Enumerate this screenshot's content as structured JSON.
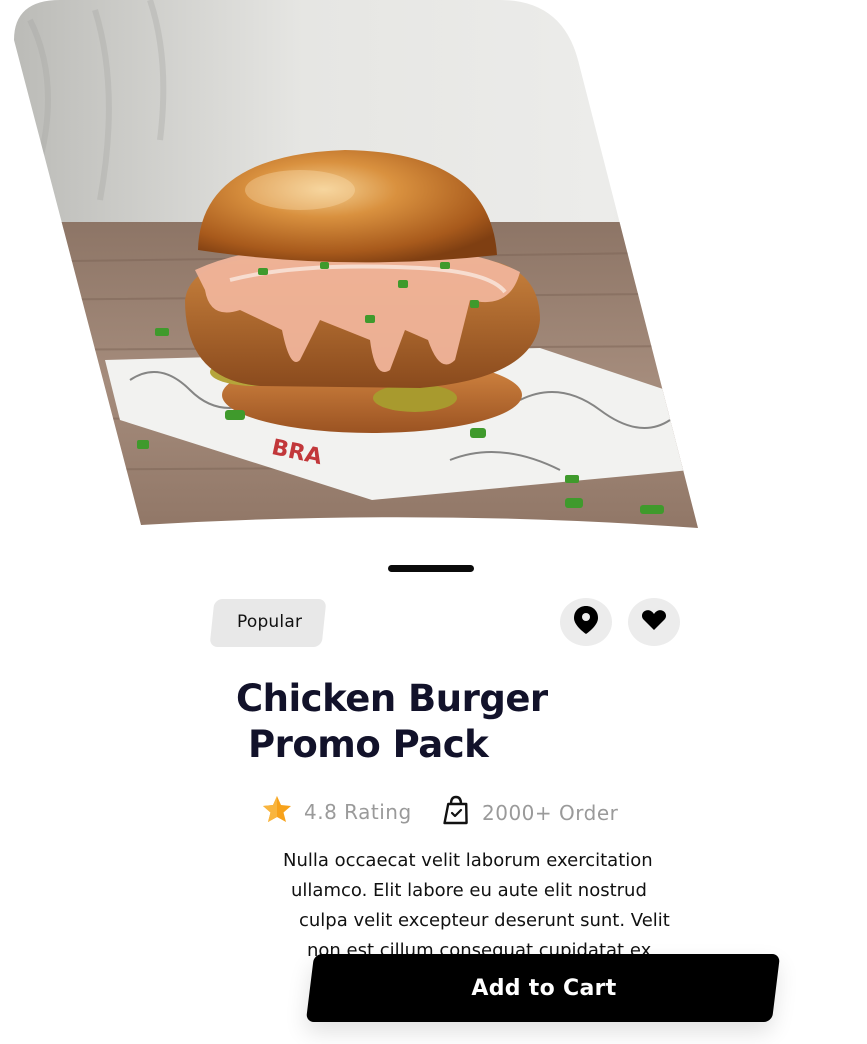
{
  "hero": {
    "image_icon": "chicken-burger-photo"
  },
  "tag": {
    "label": "Popular"
  },
  "actions": {
    "location_icon": "location-pin-icon",
    "favorite_icon": "heart-icon"
  },
  "product": {
    "title_line1": "Chicken Burger",
    "title_line2": "Promo Pack"
  },
  "stats": {
    "rating_text": "4.8 Rating",
    "orders_text": "2000+ Order"
  },
  "description": {
    "line1": "Nulla occaecat velit laborum exercitation",
    "line2": "ullamco. Elit labore eu aute elit nostrud",
    "line3": "culpa velit excepteur deserunt sunt. Velit",
    "line4": "non est cillum consequat cupidatat ex"
  },
  "cart": {
    "button_label": "Add to Cart"
  },
  "colors": {
    "accent_star": "#F7A21B",
    "title": "#12122A",
    "muted": "#9A9A9A",
    "button": "#000000"
  }
}
